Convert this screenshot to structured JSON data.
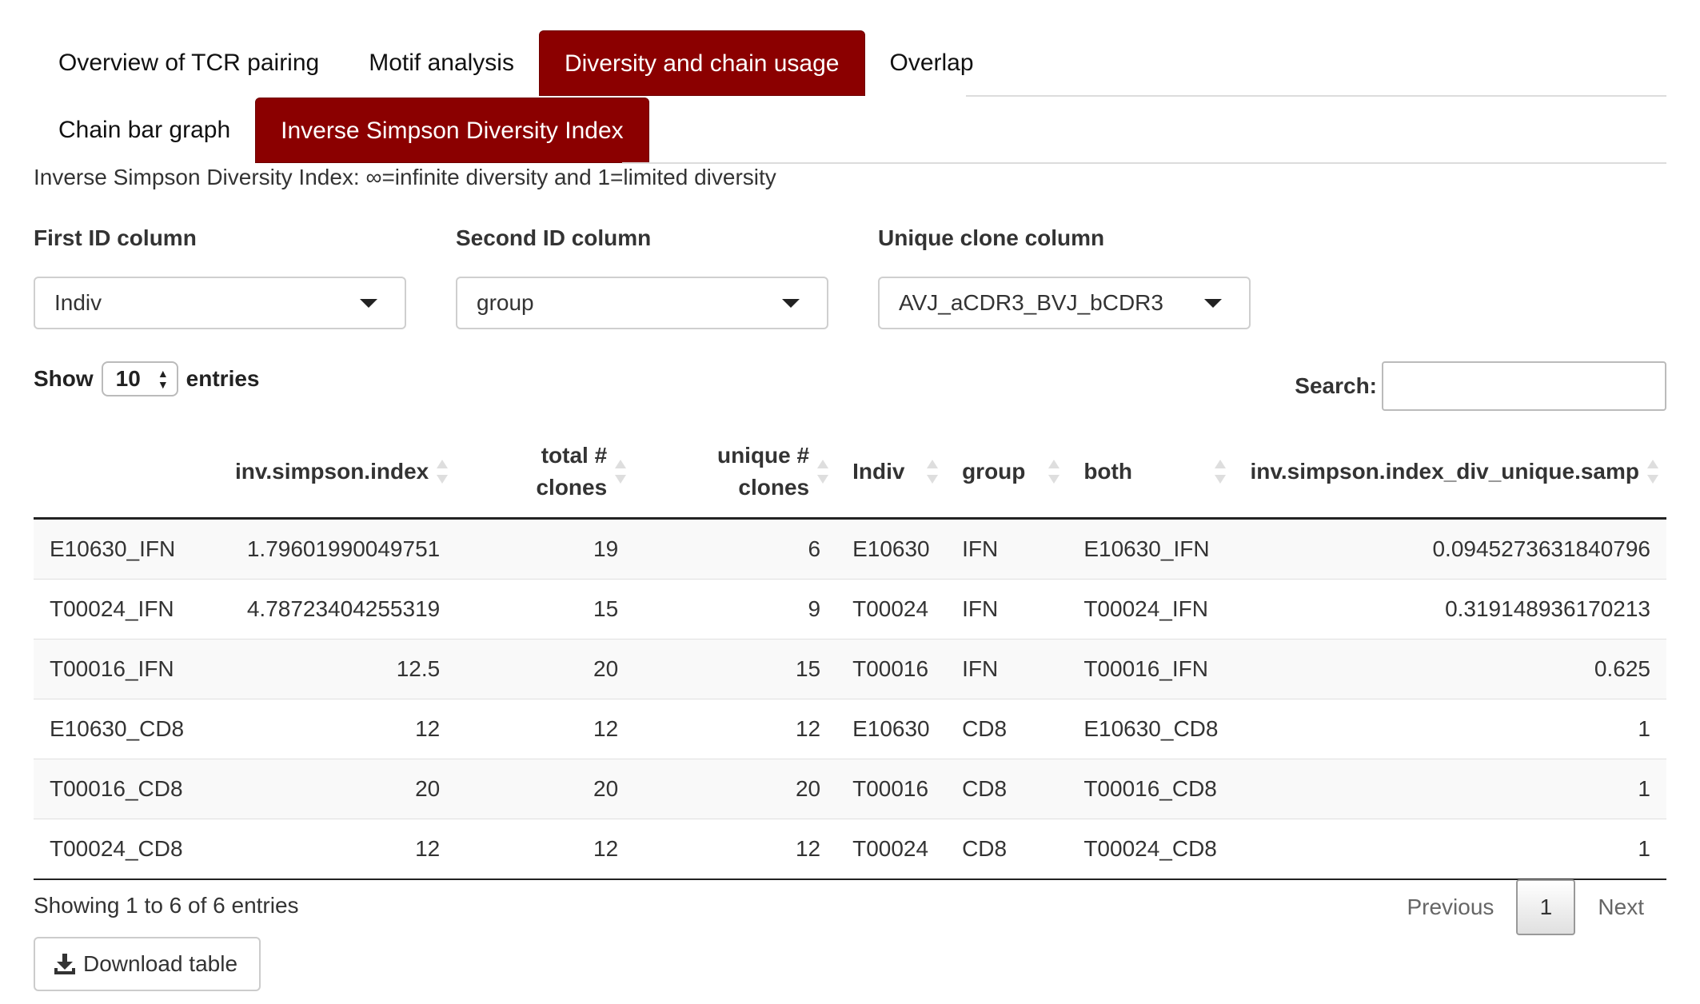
{
  "tabs": {
    "main": [
      "Overview of TCR pairing",
      "Motif analysis",
      "Diversity and chain usage",
      "Overlap"
    ],
    "main_active": 2,
    "sub": [
      "Chain bar graph",
      "Inverse Simpson Diversity Index"
    ],
    "sub_active": 1
  },
  "subtitle": "Inverse Simpson Diversity Index: ∞=infinite diversity and 1=limited diversity",
  "fields": {
    "first_id": {
      "label": "First ID column",
      "value": "Indiv"
    },
    "second_id": {
      "label": "Second ID column",
      "value": "group"
    },
    "unique_clone": {
      "label": "Unique clone column",
      "value": "AVJ_aCDR3_BVJ_bCDR3"
    }
  },
  "length": {
    "show": "Show",
    "value": "10",
    "entries": "entries"
  },
  "search": {
    "label": "Search:",
    "value": ""
  },
  "table": {
    "headers": [
      "",
      "inv.simpson.index",
      "total # clones",
      "unique # clones",
      "Indiv",
      "group",
      "both",
      "inv.simpson.index_div_unique.samp"
    ],
    "rows": [
      [
        "E10630_IFN",
        "1.79601990049751",
        "19",
        "6",
        "E10630",
        "IFN",
        "E10630_IFN",
        "0.0945273631840796"
      ],
      [
        "T00024_IFN",
        "4.78723404255319",
        "15",
        "9",
        "T00024",
        "IFN",
        "T00024_IFN",
        "0.319148936170213"
      ],
      [
        "T00016_IFN",
        "12.5",
        "20",
        "15",
        "T00016",
        "IFN",
        "T00016_IFN",
        "0.625"
      ],
      [
        "E10630_CD8",
        "12",
        "12",
        "12",
        "E10630",
        "CD8",
        "E10630_CD8",
        "1"
      ],
      [
        "T00016_CD8",
        "20",
        "20",
        "20",
        "T00016",
        "CD8",
        "T00016_CD8",
        "1"
      ],
      [
        "T00024_CD8",
        "12",
        "12",
        "12",
        "T00024",
        "CD8",
        "T00024_CD8",
        "1"
      ]
    ]
  },
  "info": "Showing 1 to 6 of 6 entries",
  "pager": {
    "previous": "Previous",
    "current": "1",
    "next": "Next"
  },
  "download": {
    "label": "Download table",
    "icon": "download-icon"
  },
  "colors": {
    "accent": "#8b0000",
    "text": "#333333",
    "border": "#cccccc"
  }
}
